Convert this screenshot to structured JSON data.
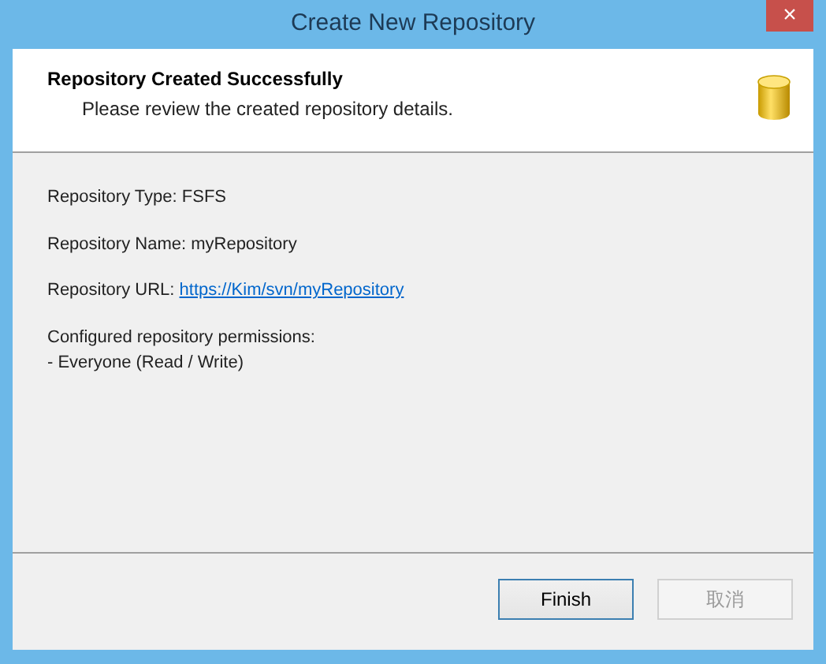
{
  "window": {
    "title": "Create New Repository",
    "close": "×"
  },
  "header": {
    "title": "Repository Created Successfully",
    "subtitle": "Please review the created repository details."
  },
  "details": [
    {
      "text": "Repository Type: FSFS"
    },
    {
      "text": "Repository Name: myRepository"
    },
    {
      "text": "Repository URL: ",
      "link": "https://Kim/svn/myRepository"
    }
  ],
  "permissions": {
    "title": "Configured repository permissions:",
    "entries": [
      "- Everyone (Read / Write)"
    ]
  },
  "buttons": [
    {
      "label": "Finish",
      "default": true,
      "disabled": false
    },
    {
      "label": "取消",
      "default": false,
      "disabled": true
    }
  ]
}
